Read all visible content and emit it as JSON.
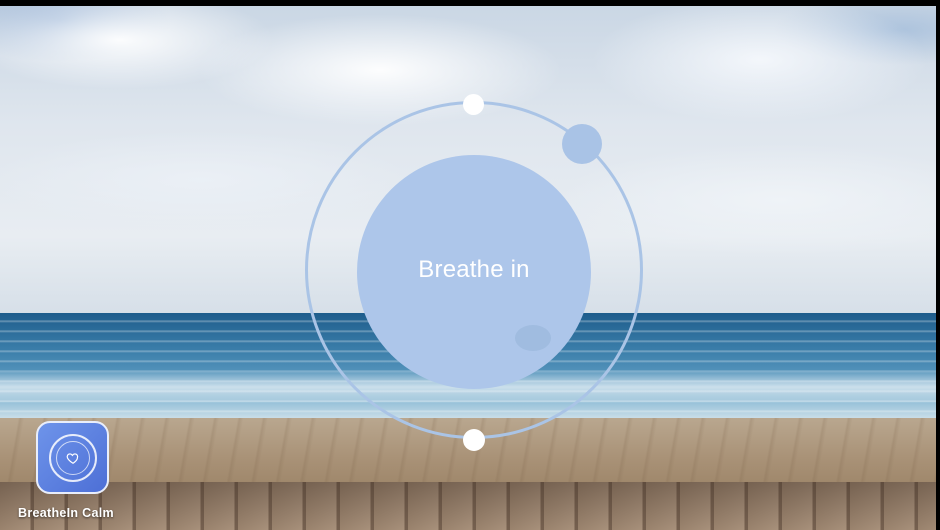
{
  "breathing": {
    "prompt": "Breathe in"
  },
  "app": {
    "name": "BreatheIn Calm",
    "icon": "heart-icon",
    "accent": "#adc6ea",
    "icon_color": "#5a7fe0"
  },
  "scene": {
    "background": "beach-photo"
  }
}
